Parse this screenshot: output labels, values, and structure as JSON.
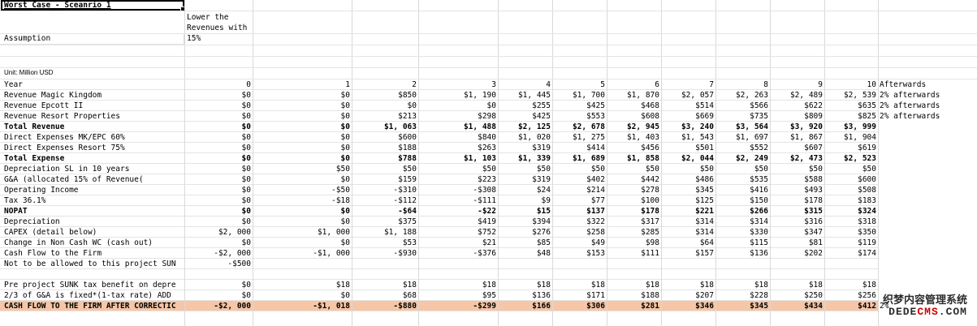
{
  "title": "Worst Case - Sceanrio 1",
  "assumption_label": "Assumption",
  "assumption_text": [
    "Lower the",
    "Revenues with",
    "15%"
  ],
  "unit_label": "Unit: Million USD",
  "rows": [
    {
      "label": "Year",
      "style": "normal",
      "values": [
        "0",
        "1",
        "2",
        "3",
        "4",
        "5",
        "6",
        "7",
        "8",
        "9",
        "10"
      ],
      "note": "Afterwards"
    },
    {
      "label": "Revenue Magic Kingdom",
      "style": "normal",
      "values": [
        "$0",
        "$0",
        "$850",
        "$1, 190",
        "$1, 445",
        "$1, 700",
        "$1, 870",
        "$2, 057",
        "$2, 263",
        "$2, 489",
        "$2, 539"
      ],
      "note": "2% afterwards"
    },
    {
      "label": "Revenue Epcott II",
      "style": "normal",
      "values": [
        "$0",
        "$0",
        "$0",
        "$0",
        "$255",
        "$425",
        "$468",
        "$514",
        "$566",
        "$622",
        "$635"
      ],
      "note": "2% afterwards"
    },
    {
      "label": "Revenue Resort Properties",
      "style": "normal",
      "values": [
        "$0",
        "$0",
        "$213",
        "$298",
        "$425",
        "$553",
        "$608",
        "$669",
        "$735",
        "$809",
        "$825"
      ],
      "note": "2% afterwards"
    },
    {
      "label": "Total Revenue",
      "style": "bold",
      "values": [
        "$0",
        "$0",
        "$1, 063",
        "$1, 488",
        "$2, 125",
        "$2, 678",
        "$2, 945",
        "$3, 240",
        "$3, 564",
        "$3, 920",
        "$3, 999"
      ],
      "note": ""
    },
    {
      "label": "Direct Expenses MK/EPC 60%",
      "style": "normal",
      "values": [
        "$0",
        "$0",
        "$600",
        "$840",
        "$1, 020",
        "$1, 275",
        "$1, 403",
        "$1, 543",
        "$1, 697",
        "$1, 867",
        "$1, 904"
      ],
      "note": ""
    },
    {
      "label": "Direct Expenses Resort 75%",
      "style": "normal",
      "values": [
        "$0",
        "$0",
        "$188",
        "$263",
        "$319",
        "$414",
        "$456",
        "$501",
        "$552",
        "$607",
        "$619"
      ],
      "note": ""
    },
    {
      "label": "Total Expense",
      "style": "bold",
      "values": [
        "$0",
        "$0",
        "$788",
        "$1, 103",
        "$1, 339",
        "$1, 689",
        "$1, 858",
        "$2, 044",
        "$2, 249",
        "$2, 473",
        "$2, 523"
      ],
      "note": ""
    },
    {
      "label": "Depreciation SL in 10 years",
      "style": "normal",
      "values": [
        "$0",
        "$50",
        "$50",
        "$50",
        "$50",
        "$50",
        "$50",
        "$50",
        "$50",
        "$50",
        "$50"
      ],
      "note": ""
    },
    {
      "label": "G&A (allocated 15% of Revenue(",
      "style": "normal",
      "values": [
        "$0",
        "$0",
        "$159",
        "$223",
        "$319",
        "$402",
        "$442",
        "$486",
        "$535",
        "$588",
        "$600"
      ],
      "note": ""
    },
    {
      "label": "Operating Income",
      "style": "normal",
      "values": [
        "$0",
        "-$50",
        "-$310",
        "-$308",
        "$24",
        "$214",
        "$278",
        "$345",
        "$416",
        "$493",
        "$508"
      ],
      "note": ""
    },
    {
      "label": "Tax 36.1%",
      "style": "normal",
      "values": [
        "$0",
        "-$18",
        "-$112",
        "-$111",
        "$9",
        "$77",
        "$100",
        "$125",
        "$150",
        "$178",
        "$183"
      ],
      "note": ""
    },
    {
      "label": "NOPAT",
      "style": "bold",
      "values": [
        "$0",
        "$0",
        "-$64",
        "-$22",
        "$15",
        "$137",
        "$178",
        "$221",
        "$266",
        "$315",
        "$324"
      ],
      "note": ""
    },
    {
      "label": "Depreciation",
      "style": "normal",
      "values": [
        "$0",
        "$0",
        "$375",
        "$419",
        "$394",
        "$322",
        "$317",
        "$314",
        "$314",
        "$316",
        "$318"
      ],
      "note": ""
    },
    {
      "label": "CAPEX (detail below)",
      "style": "normal",
      "values": [
        "$2, 000",
        "$1, 000",
        "$1, 188",
        "$752",
        "$276",
        "$258",
        "$285",
        "$314",
        "$330",
        "$347",
        "$350"
      ],
      "note": ""
    },
    {
      "label": "Change in Non Cash WC (cash out)",
      "style": "normal",
      "values": [
        "$0",
        "$0",
        "$53",
        "$21",
        "$85",
        "$49",
        "$98",
        "$64",
        "$115",
        "$81",
        "$119"
      ],
      "note": ""
    },
    {
      "label": "Cash Flow to the Firm",
      "style": "normal",
      "values": [
        "-$2, 000",
        "-$1, 000",
        "-$930",
        "-$376",
        "$48",
        "$153",
        "$111",
        "$157",
        "$136",
        "$202",
        "$174"
      ],
      "note": ""
    },
    {
      "label": "Not to be allowed to this project SUN",
      "style": "normal",
      "values": [
        "-$500",
        "",
        "",
        "",
        "",
        "",
        "",
        "",
        "",
        "",
        ""
      ],
      "note": ""
    },
    {
      "label": "",
      "style": "normal",
      "values": [
        "",
        "",
        "",
        "",
        "",
        "",
        "",
        "",
        "",
        "",
        ""
      ],
      "note": ""
    },
    {
      "label": "Pre project SUNK tax benefit on depre",
      "style": "normal",
      "values": [
        "$0",
        "$18",
        "$18",
        "$18",
        "$18",
        "$18",
        "$18",
        "$18",
        "$18",
        "$18",
        "$18"
      ],
      "note": ""
    },
    {
      "label": "2/3 of G&A is fixed*(1-tax rate) ADD",
      "style": "normal",
      "values": [
        "$0",
        "$0",
        "$68",
        "$95",
        "$136",
        "$171",
        "$188",
        "$207",
        "$228",
        "$250",
        "$256"
      ],
      "note": ""
    },
    {
      "label": "CASH FLOW TO THE FIRM AFTER CORRECTIC",
      "style": "highlight",
      "values": [
        "-$2, 000",
        "-$1, 018",
        "-$880",
        "-$299",
        "$166",
        "$306",
        "$281",
        "$346",
        "$345",
        "$434",
        "$412"
      ],
      "note": "2%"
    }
  ],
  "colors": {
    "highlight": "#f6c6a6",
    "grid": "#d9d9d9"
  },
  "watermark": {
    "line1": "织梦内容管理系统",
    "line2_a": "DEDE",
    "line2_b": "CMS",
    "line2_c": ".COM"
  }
}
